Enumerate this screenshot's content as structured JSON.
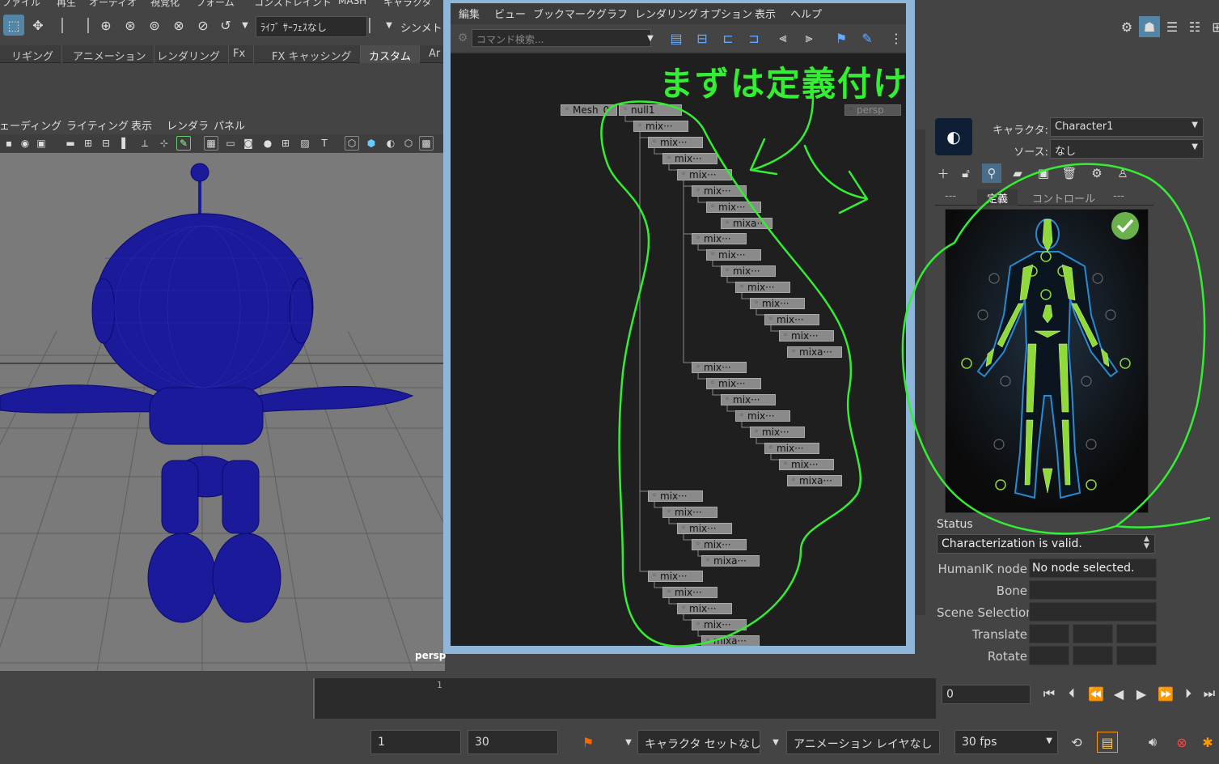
{
  "top_menu": [
    "ファイル",
    "再生",
    "オーディオ",
    "視覚化",
    "フォーム",
    "コンストレイント",
    "MASH",
    "キャラクタ"
  ],
  "toolbar": {
    "live_surface": "ﾗｲﾌﾞ ｻｰﾌｪｽなし",
    "symmetry": "シンメトリ"
  },
  "shelf_tabs": [
    "リギング",
    "アニメーション",
    "レンダリング",
    "Fx",
    "FX キャッシング",
    "カスタム",
    "Ar"
  ],
  "panel_menu": [
    "シェーディング",
    "ライティング",
    "表示",
    "レンダラ",
    "パネル"
  ],
  "viewport": {
    "camera_label": "persp"
  },
  "hypergraph": {
    "menu": [
      "編集",
      "ビュー",
      "ブックマーク",
      "グラフ",
      "レンダリング",
      "オプション",
      "表示",
      "ヘルプ"
    ],
    "search_placeholder": "コマンド検索...",
    "nodes": {
      "mesh": "Mesh_0",
      "null": "null1",
      "persp": "persp",
      "mix": "mix···",
      "mixa": "mixa···"
    }
  },
  "annotation": {
    "text": "まずは定義付け",
    "color": "#33ee33"
  },
  "humanik": {
    "character_label": "キャラクタ:",
    "character_value": "Character1",
    "source_label": "ソース:",
    "source_value": "なし",
    "tabs": [
      "---",
      "定義",
      "コントロール",
      "---"
    ],
    "active_tab": "定義",
    "status_label": "Status",
    "status_value": "Characterization is valid.",
    "props": [
      {
        "label": "HumanIK node",
        "value": "No node selected."
      },
      {
        "label": "Bone",
        "value": ""
      },
      {
        "label": "Scene Selection",
        "value": ""
      },
      {
        "label": "Translate",
        "value": ""
      },
      {
        "label": "Rotate",
        "value": ""
      }
    ]
  },
  "time_slider": {
    "tick_label": "1",
    "current_frame": "0"
  },
  "range_bar": {
    "start": "1",
    "end": "30",
    "character_set": "キャラクタ セットなし",
    "anim_layer": "アニメーション レイヤなし",
    "fps": "30 fps"
  }
}
